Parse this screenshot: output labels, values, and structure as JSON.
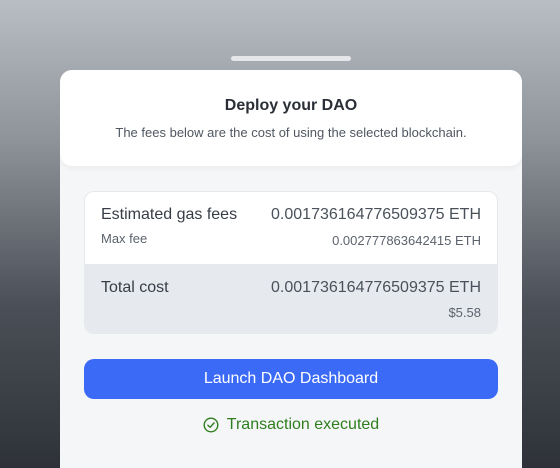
{
  "modal": {
    "title": "Deploy your DAO",
    "subtitle": "The fees below are the cost of using the selected blockchain."
  },
  "fees": {
    "estimated_label": "Estimated gas fees",
    "estimated_value": "0.001736164776509375 ETH",
    "max_label": "Max fee",
    "max_value": "0.002777863642415 ETH",
    "total_label": "Total cost",
    "total_value": "0.001736164776509375 ETH",
    "total_usd": "$5.58"
  },
  "actions": {
    "launch_label": "Launch DAO Dashboard"
  },
  "status": {
    "text": "Transaction executed",
    "icon": "check-circle-icon",
    "color": "#2f7d1f"
  },
  "colors": {
    "accent": "#3b6af6"
  }
}
